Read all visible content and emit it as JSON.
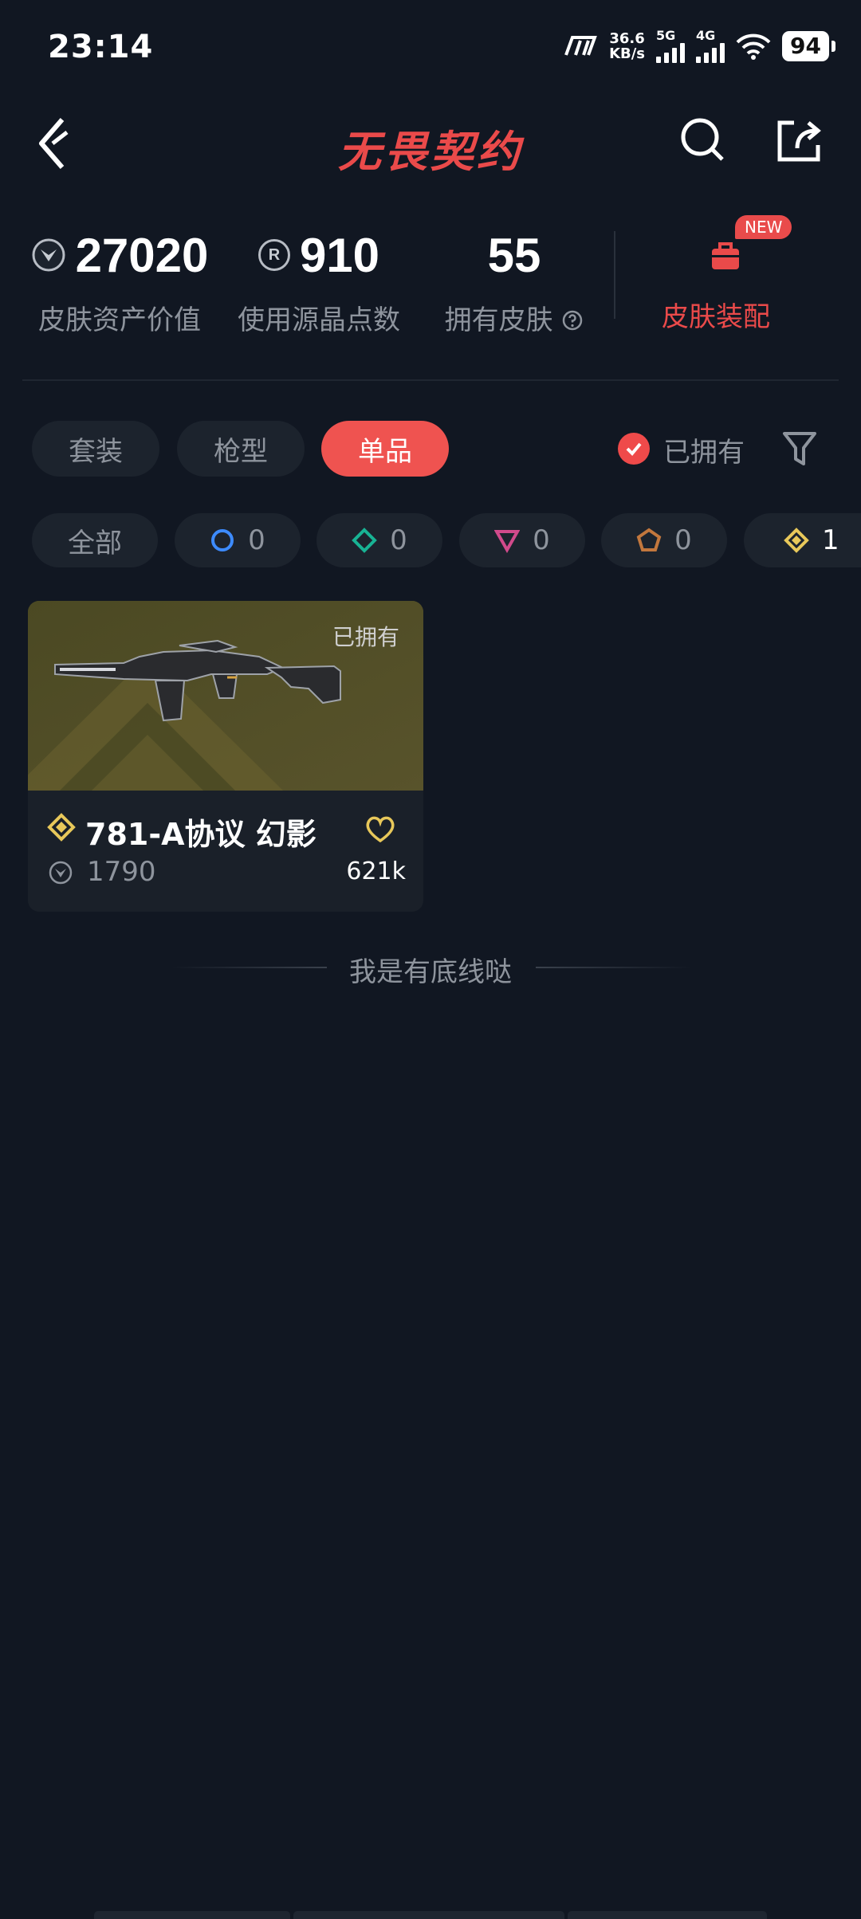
{
  "status_bar": {
    "time": "23:14",
    "net_speed_top": "36.6",
    "net_speed_bottom": "KB/s",
    "sig1": "5G",
    "sig2": "4G",
    "battery": "94"
  },
  "header": {
    "title": "无畏契约"
  },
  "stats": [
    {
      "value": "27020",
      "label": "皮肤资产价值"
    },
    {
      "value": "910",
      "label": "使用源晶点数"
    },
    {
      "value": "55",
      "label": "拥有皮肤"
    }
  ],
  "outfit": {
    "badge": "NEW",
    "label": "皮肤装配"
  },
  "tabs": [
    {
      "label": "套装"
    },
    {
      "label": "枪型"
    },
    {
      "label": "单品",
      "active": true
    }
  ],
  "owned_filter": {
    "label": "已拥有",
    "checked": true
  },
  "rarity_chips": [
    {
      "label": "全部"
    },
    {
      "count": "0",
      "color": "#3d8bff"
    },
    {
      "count": "0",
      "color": "#18b394"
    },
    {
      "count": "0",
      "color": "#d14a8b"
    },
    {
      "count": "0",
      "color": "#c2773d"
    },
    {
      "count": "1",
      "color": "#e8c85a"
    }
  ],
  "items": [
    {
      "owned_tag": "已拥有",
      "name": "781-A协议 幻影",
      "price": "1790",
      "likes": "621k",
      "rarity_color": "#e8c85a"
    }
  ],
  "end_text": "我是有底线哒"
}
